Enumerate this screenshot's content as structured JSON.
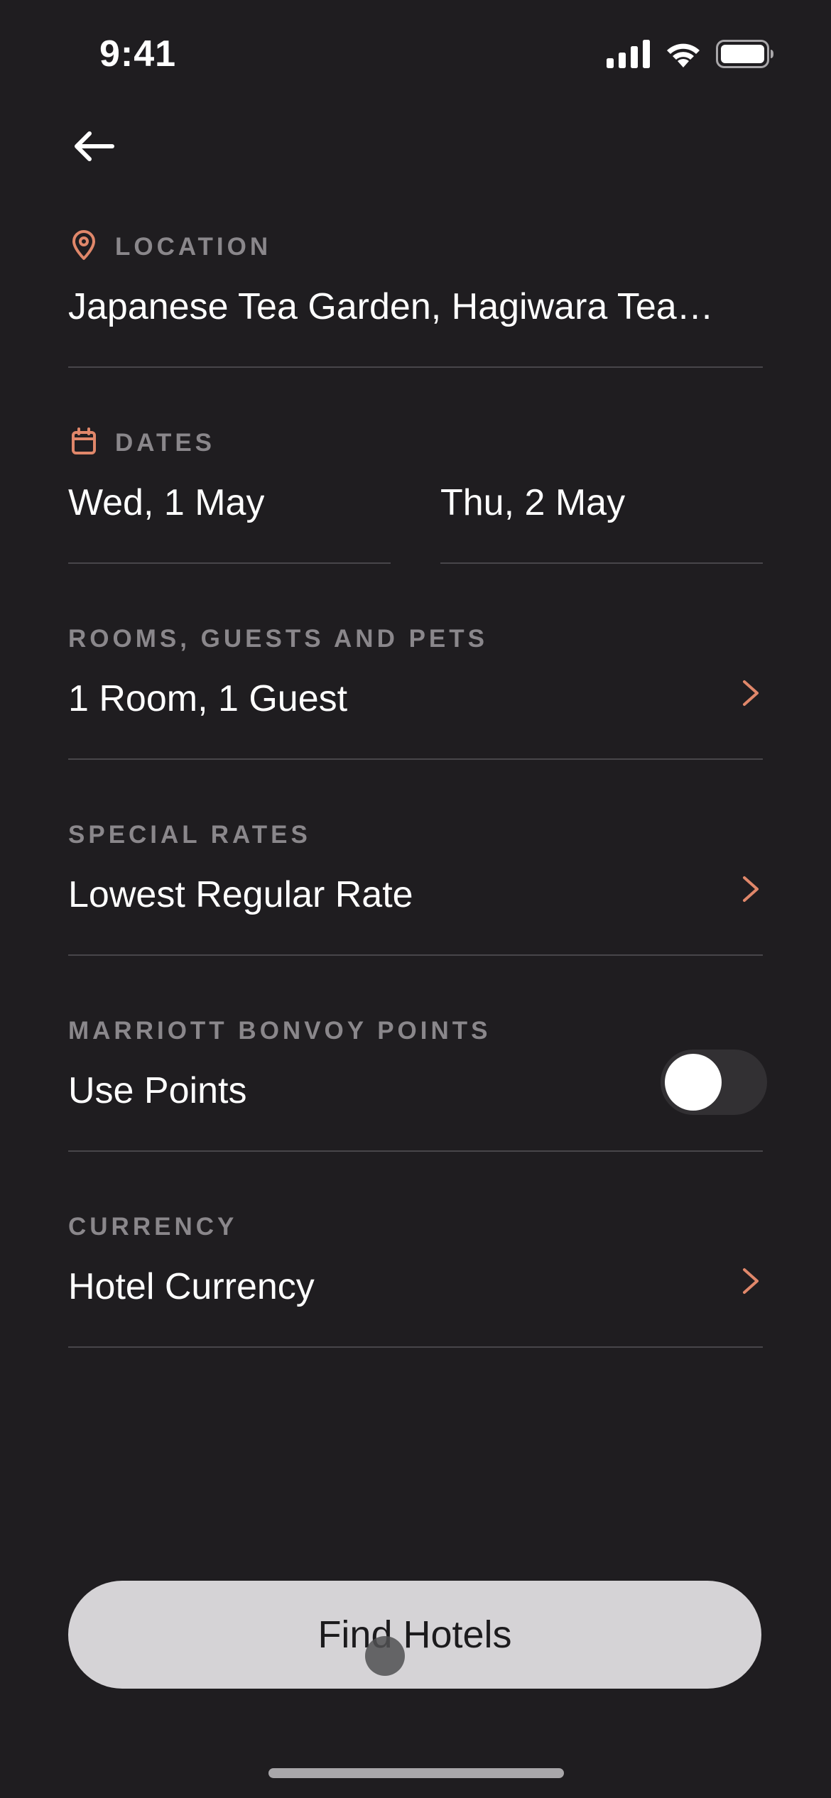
{
  "status_bar": {
    "time": "9:41"
  },
  "nav": {
    "back_icon": "arrow-left-icon"
  },
  "location": {
    "label": "LOCATION",
    "icon": "map-pin-icon",
    "value": "Japanese Tea Garden, Hagiwara Tea…"
  },
  "dates": {
    "label": "DATES",
    "icon": "calendar-icon",
    "check_in": "Wed, 1 May",
    "check_out": "Thu, 2 May"
  },
  "rooms": {
    "label": "ROOMS, GUESTS AND PETS",
    "value": "1 Room, 1 Guest"
  },
  "special_rates": {
    "label": "SPECIAL RATES",
    "value": "Lowest Regular Rate"
  },
  "points": {
    "label": "MARRIOTT BONVOY POINTS",
    "value": "Use Points",
    "toggle_on": false
  },
  "currency": {
    "label": "CURRENCY",
    "value": "Hotel Currency"
  },
  "cta": {
    "label": "Find Hotels"
  },
  "colors": {
    "background": "#1f1d20",
    "accent": "#e0876a",
    "label": "#8a878b",
    "divider": "#48464a",
    "button_bg": "#d5d3d6"
  }
}
